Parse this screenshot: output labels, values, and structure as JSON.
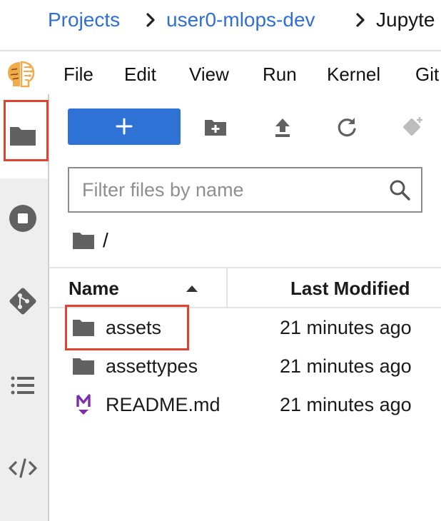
{
  "breadcrumb": {
    "items": [
      "Projects",
      "user0-mlops-dev",
      "Jupyte"
    ]
  },
  "menubar": {
    "logo_icon": "brain-logo-icon",
    "items": [
      "File",
      "Edit",
      "View",
      "Run",
      "Kernel",
      "Git"
    ]
  },
  "activity_bar": {
    "icons": [
      "folder-icon",
      "stop-circle-icon",
      "git-icon",
      "list-icon",
      "code-icon"
    ]
  },
  "toolbar": {
    "new_label": "+",
    "icons": [
      "new-folder-icon",
      "upload-icon",
      "refresh-icon",
      "git-clone-icon"
    ]
  },
  "filter": {
    "placeholder": "Filter files by name",
    "value": ""
  },
  "path": {
    "text": "/"
  },
  "table": {
    "headers": [
      "Name",
      "Last Modified"
    ],
    "rows": [
      {
        "name": "assets",
        "modified": "21 minutes ago",
        "icon": "folder-icon"
      },
      {
        "name": "assettypes",
        "modified": "21 minutes ago",
        "icon": "folder-icon"
      },
      {
        "name": "README.md",
        "modified": "21 minutes ago",
        "icon": "markdown-icon"
      }
    ]
  },
  "colors": {
    "link": "#2f6fd6",
    "primary_button": "#2e72d6",
    "highlight": "#e0432f",
    "markdown": "#7b2fb0"
  }
}
